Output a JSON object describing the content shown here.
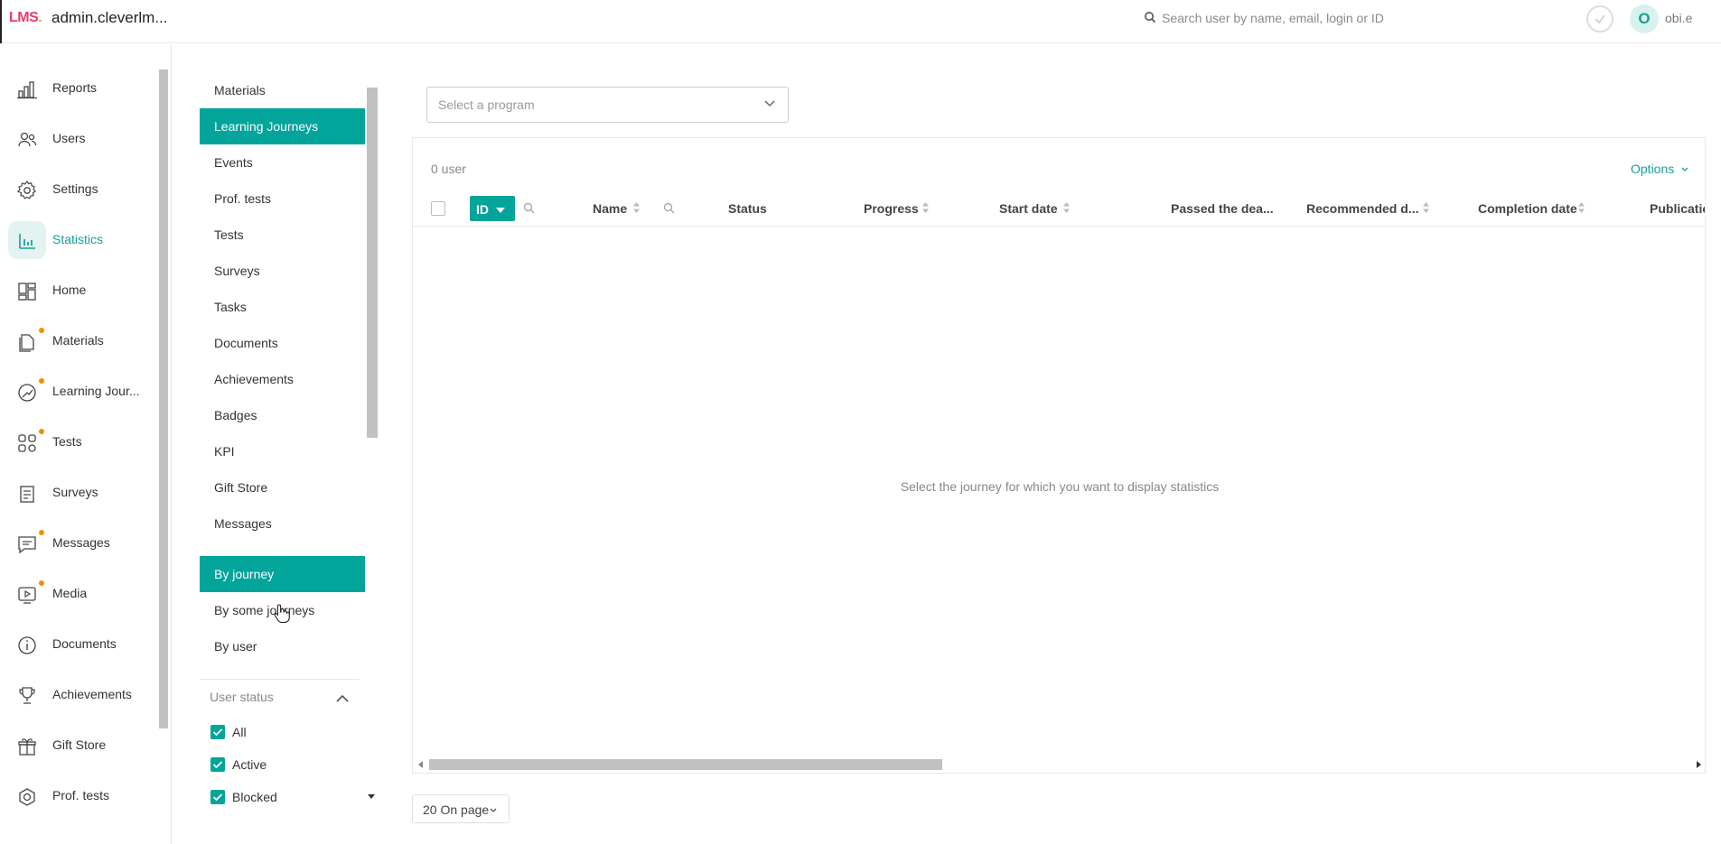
{
  "topbar": {
    "logo_main": "LMS",
    "logo_accent": ".",
    "domain": "admin.cleverlm...",
    "search_placeholder": "Search user by name, email, login or ID",
    "avatar_letter": "O",
    "username": "obi.e"
  },
  "leftnav": {
    "items": [
      {
        "label": "Reports",
        "icon": "reports-icon",
        "dot": false
      },
      {
        "label": "Users",
        "icon": "users-icon",
        "dot": false
      },
      {
        "label": "Settings",
        "icon": "gear-icon",
        "dot": false
      },
      {
        "label": "Statistics",
        "icon": "statistics-icon",
        "dot": false,
        "active": true
      },
      {
        "label": "Home",
        "icon": "home-icon",
        "dot": false
      },
      {
        "label": "Materials",
        "icon": "materials-icon",
        "dot": true
      },
      {
        "label": "Learning Jour...",
        "icon": "journey-icon",
        "dot": true
      },
      {
        "label": "Tests",
        "icon": "tests-icon",
        "dot": true
      },
      {
        "label": "Surveys",
        "icon": "surveys-icon",
        "dot": false
      },
      {
        "label": "Messages",
        "icon": "messages-icon",
        "dot": true
      },
      {
        "label": "Media",
        "icon": "media-icon",
        "dot": true
      },
      {
        "label": "Documents",
        "icon": "documents-icon",
        "dot": false
      },
      {
        "label": "Achievements",
        "icon": "trophy-icon",
        "dot": false
      },
      {
        "label": "Gift Store",
        "icon": "gift-icon",
        "dot": false
      },
      {
        "label": "Prof. tests",
        "icon": "prof-tests-icon",
        "dot": false
      }
    ]
  },
  "subnav": {
    "items": [
      {
        "label": "Materials"
      },
      {
        "label": "Learning Journeys",
        "active": true
      },
      {
        "label": "Events"
      },
      {
        "label": "Prof. tests"
      },
      {
        "label": "Tests"
      },
      {
        "label": "Surveys"
      },
      {
        "label": "Tasks"
      },
      {
        "label": "Documents"
      },
      {
        "label": "Achievements"
      },
      {
        "label": "Badges"
      },
      {
        "label": "KPI"
      },
      {
        "label": "Gift Store"
      },
      {
        "label": "Messages"
      }
    ],
    "modes": [
      {
        "label": "By journey",
        "active": true
      },
      {
        "label": "By some journeys"
      },
      {
        "label": "By user"
      }
    ],
    "user_status_title": "User status",
    "statuses": [
      {
        "label": "All",
        "checked": true
      },
      {
        "label": "Active",
        "checked": true
      },
      {
        "label": "Blocked",
        "checked": true
      }
    ]
  },
  "main": {
    "program_placeholder": "Select a program",
    "user_count": "0 user",
    "options_label": "Options",
    "columns": {
      "id": "ID",
      "name": "Name",
      "status": "Status",
      "progress": "Progress",
      "start_date": "Start date",
      "passed_deadline": "Passed the dea...",
      "recommended": "Recommended d...",
      "completion": "Completion date",
      "publication": "Publicatio"
    },
    "empty_message": "Select the journey for which you want to display statistics",
    "pager_label": "20 On page"
  },
  "colors": {
    "accent": "#03a59b",
    "accent_text": "#17a097",
    "dot": "#f09000"
  }
}
